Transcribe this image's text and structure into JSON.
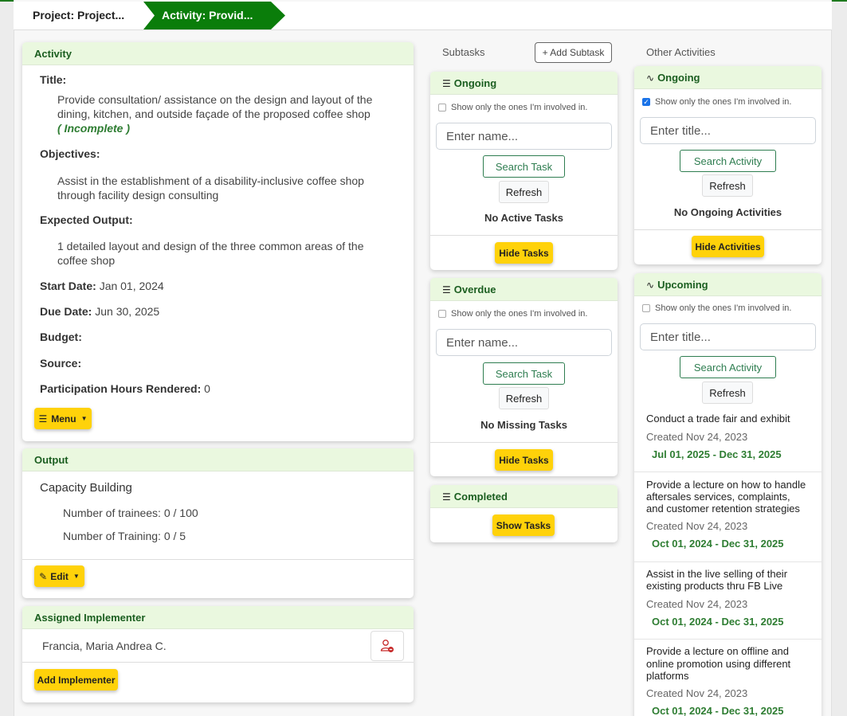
{
  "breadcrumb": {
    "project": "Project: Project...",
    "activity": "Activity: Provid..."
  },
  "activity": {
    "header": "Activity",
    "title_label": "Title:",
    "title_line1": "Provide consultation/ assistance on the design and layout of the",
    "title_line2": "dining, kitchen, and outside façade of the proposed coffee shop",
    "status": "( Incomplete )",
    "objectives_label": "Objectives:",
    "objectives_line1": "Assist in the establishment of a disability-inclusive coffee shop",
    "objectives_line2": "through facility design consulting",
    "output_label": "Expected Output:",
    "output_line1": "1 detailed layout and design of the three common areas of the",
    "output_line2": "coffee shop",
    "start_label": "Start Date:",
    "start_value": "Jan 01, 2024",
    "due_label": "Due Date:",
    "due_value": "Jun 30, 2025",
    "budget_label": "Budget:",
    "source_label": "Source:",
    "hours_label": "Participation Hours Rendered:",
    "hours_value": "0",
    "menu_button": "Menu"
  },
  "output": {
    "header": "Output",
    "name": "Capacity Building",
    "trainees": "Number of trainees: 0 / 100",
    "training": "Number of Training: 0 / 5",
    "edit_button": "Edit"
  },
  "implementer": {
    "header": "Assigned Implementer",
    "name": "Francia, Maria Andrea C.",
    "add_button": "Add Implementer"
  },
  "subtasks": {
    "title": "Subtasks",
    "add_button": "+ Add Subtask",
    "ongoing": {
      "header": "Ongoing",
      "involved": "Show only the ones I'm involved in.",
      "placeholder": "Enter name...",
      "search": "Search Task",
      "refresh": "Refresh",
      "empty": "No Active Tasks",
      "toggle": "Hide Tasks"
    },
    "overdue": {
      "header": "Overdue",
      "involved": "Show only the ones I'm involved in.",
      "placeholder": "Enter name...",
      "search": "Search Task",
      "refresh": "Refresh",
      "empty": "No Missing Tasks",
      "toggle": "Hide Tasks"
    },
    "completed": {
      "header": "Completed",
      "toggle": "Show Tasks"
    }
  },
  "other": {
    "title": "Other Activities",
    "ongoing": {
      "header": "Ongoing",
      "involved": "Show only the ones I'm involved in.",
      "placeholder": "Enter title...",
      "search": "Search Activity",
      "refresh": "Refresh",
      "empty": "No Ongoing Activities",
      "toggle": "Hide Activities"
    },
    "upcoming": {
      "header": "Upcoming",
      "involved": "Show only the ones I'm involved in.",
      "placeholder": "Enter title...",
      "search": "Search Activity",
      "refresh": "Refresh",
      "items": [
        {
          "l1": "Conduct a trade fair and exhibit",
          "l2": "",
          "l3": "",
          "created": "Created Nov 24, 2023",
          "dates": "Jul 01, 2025 - Dec 31, 2025"
        },
        {
          "l1": "Provide a lecture on how to handle",
          "l2": "aftersales services, complaints,",
          "l3": "and customer retention strategies",
          "created": "Created Nov 24, 2023",
          "dates": "Oct 01, 2024 - Dec 31, 2025"
        },
        {
          "l1": "Assist in the live selling of their",
          "l2": "existing products thru FB Live",
          "l3": "",
          "created": "Created Nov 24, 2023",
          "dates": "Oct 01, 2024 - Dec 31, 2025"
        },
        {
          "l1": "Provide a lecture on offline and",
          "l2": "online promotion using different",
          "l3": "platforms",
          "created": "Created Nov 24, 2023",
          "dates": "Oct 01, 2024 - Dec 31, 2025"
        }
      ]
    }
  }
}
